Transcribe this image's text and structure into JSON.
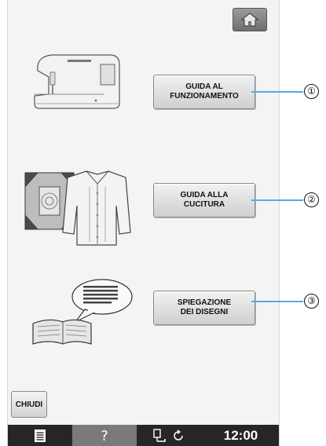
{
  "buttons": {
    "operation_guide": [
      "GUIDA AL",
      "FUNZIONAMENTO"
    ],
    "sewing_guide": [
      "GUIDA ALLA",
      "CUCITURA"
    ],
    "pattern_explanation": [
      "SPIEGAZIONE",
      "DEI DISEGNI"
    ]
  },
  "callouts": [
    "①",
    "②",
    "③"
  ],
  "close_label": "CHIUDI",
  "status_bar": {
    "clock": "12:00",
    "icons": [
      "document-icon",
      "help-icon",
      "presser-foot-icon",
      "rotate-icon"
    ]
  },
  "colors": {
    "callout_line": "#5aa9dd",
    "bar_bg": "#262626",
    "help_cell": "#7a7a7a"
  },
  "icons": {
    "home": "home-icon",
    "sewing_machine": "sewing-machine-illustration",
    "quilt_and_shirt": "quilt-shirt-illustration",
    "book": "book-speech-illustration"
  }
}
